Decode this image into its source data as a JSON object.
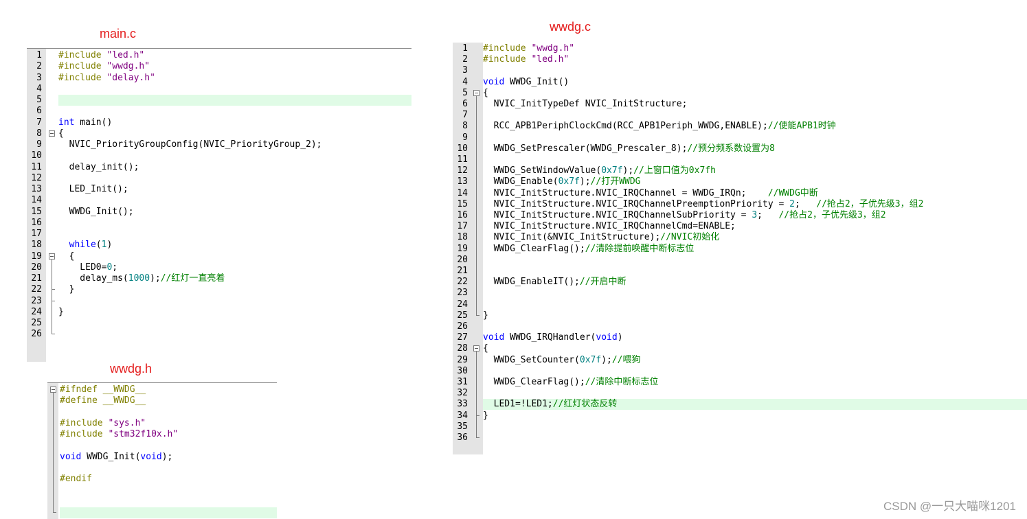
{
  "panels": {
    "main": {
      "title": "main.c",
      "lines": [
        {
          "n": "1",
          "tokens": [
            {
              "c": "pp",
              "t": "#include "
            },
            {
              "c": "str",
              "t": "\"led.h\""
            }
          ]
        },
        {
          "n": "2",
          "tokens": [
            {
              "c": "pp",
              "t": "#include "
            },
            {
              "c": "str",
              "t": "\"wwdg.h\""
            }
          ]
        },
        {
          "n": "3",
          "tokens": [
            {
              "c": "pp",
              "t": "#include "
            },
            {
              "c": "str",
              "t": "\"delay.h\""
            }
          ]
        },
        {
          "n": "4",
          "tokens": []
        },
        {
          "n": "5",
          "hl": true,
          "tokens": []
        },
        {
          "n": "6",
          "tokens": []
        },
        {
          "n": "7",
          "tokens": [
            {
              "c": "kw",
              "t": "int"
            },
            {
              "t": " main()"
            }
          ]
        },
        {
          "n": "8",
          "fold": "open",
          "tokens": [
            {
              "t": "{"
            }
          ]
        },
        {
          "n": "9",
          "tokens": [
            {
              "t": "  NVIC_PriorityGroupConfig(NVIC_PriorityGroup_2);"
            }
          ]
        },
        {
          "n": "10",
          "tokens": []
        },
        {
          "n": "11",
          "tokens": [
            {
              "t": "  delay_init();"
            }
          ]
        },
        {
          "n": "12",
          "tokens": []
        },
        {
          "n": "13",
          "tokens": [
            {
              "t": "  LED_Init();"
            }
          ]
        },
        {
          "n": "14",
          "tokens": []
        },
        {
          "n": "15",
          "tokens": [
            {
              "t": "  WWDG_Init();"
            }
          ]
        },
        {
          "n": "16",
          "tokens": []
        },
        {
          "n": "17",
          "tokens": []
        },
        {
          "n": "18",
          "tokens": [
            {
              "t": "  "
            },
            {
              "c": "kw",
              "t": "while"
            },
            {
              "t": "("
            },
            {
              "c": "num",
              "t": "1"
            },
            {
              "t": ")"
            }
          ]
        },
        {
          "n": "19",
          "fold": "open",
          "tokens": [
            {
              "t": "  {"
            }
          ]
        },
        {
          "n": "20",
          "tokens": [
            {
              "t": "    LED0="
            },
            {
              "c": "num",
              "t": "0"
            },
            {
              "t": ";"
            }
          ]
        },
        {
          "n": "21",
          "tokens": [
            {
              "t": "    delay_ms("
            },
            {
              "c": "num",
              "t": "1000"
            },
            {
              "t": ");"
            },
            {
              "c": "cm",
              "t": "//红灯一直亮着"
            }
          ]
        },
        {
          "n": "22",
          "fold": "end",
          "tokens": [
            {
              "t": "  }"
            }
          ]
        },
        {
          "n": "23",
          "fold": "end",
          "tokens": []
        },
        {
          "n": "24",
          "tokens": [
            {
              "t": "}"
            }
          ]
        },
        {
          "n": "25",
          "tokens": []
        },
        {
          "n": "26",
          "fold": "end",
          "tokens": []
        }
      ]
    },
    "wwdgh": {
      "title": "wwdg.h",
      "lines": [
        {
          "n": "",
          "fold": "open",
          "tokens": [
            {
              "c": "pp",
              "t": "#ifndef __WWDG__"
            }
          ]
        },
        {
          "n": "",
          "tokens": [
            {
              "c": "pp",
              "t": "#define __WWDG__"
            }
          ]
        },
        {
          "n": "",
          "tokens": []
        },
        {
          "n": "",
          "tokens": [
            {
              "c": "pp",
              "t": "#include "
            },
            {
              "c": "str",
              "t": "\"sys.h\""
            }
          ]
        },
        {
          "n": "",
          "tokens": [
            {
              "c": "pp",
              "t": "#include "
            },
            {
              "c": "str",
              "t": "\"stm32f10x.h\""
            }
          ]
        },
        {
          "n": "",
          "tokens": []
        },
        {
          "n": "",
          "tokens": [
            {
              "c": "kw",
              "t": "void"
            },
            {
              "t": " WWDG_Init("
            },
            {
              "c": "kw",
              "t": "void"
            },
            {
              "t": ");"
            }
          ]
        },
        {
          "n": "",
          "tokens": []
        },
        {
          "n": "",
          "tokens": [
            {
              "c": "pp",
              "t": "#endif"
            }
          ]
        },
        {
          "n": "",
          "tokens": []
        },
        {
          "n": "",
          "tokens": []
        },
        {
          "n": "",
          "fold": "end",
          "hl": true,
          "tokens": []
        }
      ]
    },
    "wwdgc": {
      "title": "wwdg.c",
      "lines": [
        {
          "n": "1",
          "tokens": [
            {
              "c": "pp",
              "t": "#include "
            },
            {
              "c": "str",
              "t": "\"wwdg.h\""
            }
          ]
        },
        {
          "n": "2",
          "tokens": [
            {
              "c": "pp",
              "t": "#include "
            },
            {
              "c": "str",
              "t": "\"led.h\""
            }
          ]
        },
        {
          "n": "3",
          "tokens": []
        },
        {
          "n": "4",
          "tokens": [
            {
              "c": "kw",
              "t": "void"
            },
            {
              "t": " WWDG_Init()"
            }
          ]
        },
        {
          "n": "5",
          "fold": "open",
          "tokens": [
            {
              "t": "{"
            }
          ]
        },
        {
          "n": "6",
          "tokens": [
            {
              "t": "  NVIC_InitTypeDef NVIC_InitStructure;"
            }
          ]
        },
        {
          "n": "7",
          "tokens": []
        },
        {
          "n": "8",
          "tokens": [
            {
              "t": "  RCC_APB1PeriphClockCmd(RCC_APB1Periph_WWDG,ENABLE);"
            },
            {
              "c": "cm",
              "t": "//使能APB1时钟"
            }
          ]
        },
        {
          "n": "9",
          "tokens": []
        },
        {
          "n": "10",
          "tokens": [
            {
              "t": "  WWDG_SetPrescaler(WWDG_Prescaler_8);"
            },
            {
              "c": "cm",
              "t": "//预分频系数设置为8"
            }
          ]
        },
        {
          "n": "11",
          "tokens": []
        },
        {
          "n": "12",
          "tokens": [
            {
              "t": "  WWDG_SetWindowValue("
            },
            {
              "c": "num",
              "t": "0x7f"
            },
            {
              "t": ");"
            },
            {
              "c": "cm",
              "t": "//上窗口值为0x7fh"
            }
          ]
        },
        {
          "n": "13",
          "tokens": [
            {
              "t": "  WWDG_Enable("
            },
            {
              "c": "num",
              "t": "0x7f"
            },
            {
              "t": ");"
            },
            {
              "c": "cm",
              "t": "//打开WWDG"
            }
          ]
        },
        {
          "n": "14",
          "tokens": [
            {
              "t": "  NVIC_InitStructure.NVIC_IRQChannel = WWDG_IRQn;    "
            },
            {
              "c": "cm",
              "t": "//WWDG中断"
            }
          ]
        },
        {
          "n": "15",
          "tokens": [
            {
              "t": "  NVIC_InitStructure.NVIC_IRQChannelPreemptionPriority = "
            },
            {
              "c": "num",
              "t": "2"
            },
            {
              "t": ";   "
            },
            {
              "c": "cm",
              "t": "//抢占2，子优先级3，组2"
            }
          ]
        },
        {
          "n": "16",
          "tokens": [
            {
              "t": "  NVIC_InitStructure.NVIC_IRQChannelSubPriority = "
            },
            {
              "c": "num",
              "t": "3"
            },
            {
              "t": ";   "
            },
            {
              "c": "cm",
              "t": "//抢占2，子优先级3，组2"
            }
          ]
        },
        {
          "n": "17",
          "tokens": [
            {
              "t": "  NVIC_InitStructure.NVIC_IRQChannelCmd=ENABLE;"
            }
          ]
        },
        {
          "n": "18",
          "tokens": [
            {
              "t": "  NVIC_Init(&NVIC_InitStructure);"
            },
            {
              "c": "cm",
              "t": "//NVIC初始化"
            }
          ]
        },
        {
          "n": "19",
          "tokens": [
            {
              "t": "  WWDG_ClearFlag();"
            },
            {
              "c": "cm",
              "t": "//清除提前唤醒中断标志位"
            }
          ]
        },
        {
          "n": "20",
          "tokens": []
        },
        {
          "n": "21",
          "tokens": []
        },
        {
          "n": "22",
          "tokens": [
            {
              "t": "  WWDG_EnableIT();"
            },
            {
              "c": "cm",
              "t": "//开启中断"
            }
          ]
        },
        {
          "n": "23",
          "tokens": []
        },
        {
          "n": "24",
          "tokens": []
        },
        {
          "n": "25",
          "fold": "end",
          "tokens": [
            {
              "t": "}"
            }
          ]
        },
        {
          "n": "26",
          "tokens": []
        },
        {
          "n": "27",
          "tokens": [
            {
              "c": "kw",
              "t": "void"
            },
            {
              "t": " WWDG_IRQHandler("
            },
            {
              "c": "kw",
              "t": "void"
            },
            {
              "t": ")"
            }
          ]
        },
        {
          "n": "28",
          "fold": "open",
          "tokens": [
            {
              "t": "{"
            }
          ]
        },
        {
          "n": "29",
          "tokens": [
            {
              "t": "  WWDG_SetCounter("
            },
            {
              "c": "num",
              "t": "0x7f"
            },
            {
              "t": ");"
            },
            {
              "c": "cm",
              "t": "//喂狗"
            }
          ]
        },
        {
          "n": "30",
          "tokens": []
        },
        {
          "n": "31",
          "tokens": [
            {
              "t": "  WWDG_ClearFlag();"
            },
            {
              "c": "cm",
              "t": "//清除中断标志位"
            }
          ]
        },
        {
          "n": "32",
          "tokens": []
        },
        {
          "n": "33",
          "hl": true,
          "tokens": [
            {
              "t": "  LED1=!LED1;"
            },
            {
              "c": "cm",
              "t": "//红灯状态反转"
            }
          ]
        },
        {
          "n": "34",
          "fold": "end",
          "tokens": [
            {
              "t": "}"
            }
          ]
        },
        {
          "n": "35",
          "tokens": []
        },
        {
          "n": "36",
          "fold": "end",
          "tokens": []
        }
      ]
    }
  },
  "watermark": "CSDN @一只大喵咪1201",
  "colors": {
    "title": "#e41e1e",
    "preprocessor": "#808000",
    "string": "#800080",
    "keyword": "#0000ff",
    "number": "#008080",
    "comment": "#008000",
    "highlight": "#e0fbe6",
    "gutter": "#e4e4e4"
  }
}
